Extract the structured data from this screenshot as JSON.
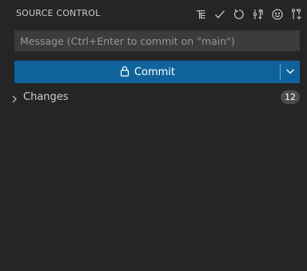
{
  "panel": {
    "title": "SOURCE CONTROL",
    "toolbar": [
      {
        "name": "view-as-tree-icon",
        "tooltip": ""
      },
      {
        "name": "check-icon",
        "tooltip": ""
      },
      {
        "name": "refresh-icon",
        "tooltip": ""
      },
      {
        "name": "git-branch-icon",
        "tooltip": ""
      },
      {
        "name": "smiley-icon",
        "tooltip": ""
      },
      {
        "name": "pull-request-create-icon",
        "tooltip": ""
      }
    ]
  },
  "commit_message": {
    "value": "",
    "placeholder": "Message (Ctrl+Enter to commit on \"main\")"
  },
  "commit_button": {
    "label": "Commit",
    "icon": "lock-icon"
  },
  "changes_group": {
    "label": "Changes",
    "count": "12",
    "expanded": false
  },
  "colors": {
    "background": "#252526",
    "input_background": "#3c3c3c",
    "button_background": "#0e639c",
    "badge_background": "#4d4d4d",
    "foreground": "#cccccc"
  }
}
